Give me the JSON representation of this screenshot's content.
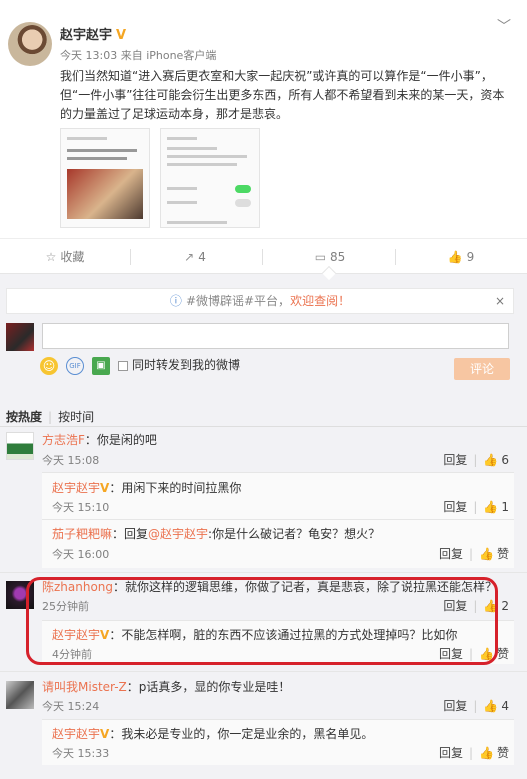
{
  "post": {
    "author": "赵宇赵宇",
    "verified_badge": "V",
    "meta": "今天 13:03 来自 iPhone客户端",
    "text": "我们当然知道“进入赛后更衣室和大家一起庆祝”或许真的可以算作是“一件小事”，但“一件小事”往往可能会衍生出更多东西，所有人都不希望看到未来的某一天，资本的力量盖过了足球运动本身，那才是悲哀。",
    "menu_icon": "chevron-down-icon"
  },
  "actions": {
    "favorite": "收藏",
    "forward": "4",
    "comment": "85",
    "like": "9"
  },
  "notice": {
    "tag": "#微博辟谣#平台，",
    "link": "欢迎查阅！",
    "close": "×"
  },
  "composer": {
    "also_forward": "同时转发到我的微博",
    "submit": "评论"
  },
  "sort": {
    "hot": "按热度",
    "time": "按时间"
  },
  "ops": {
    "reply": "回复",
    "like": "赞"
  },
  "comments": [
    {
      "name": "方志浩F",
      "text": "：你是闲的吧",
      "time": "今天 15:08",
      "likes": "6",
      "replies": [
        {
          "name": "赵宇赵宇",
          "text": "：用闲下来的时间拉黑你",
          "time": "今天 15:10",
          "likes": "1"
        },
        {
          "name": "茄子粑粑嘛",
          "pre": "：回复",
          "at": "@赵宇赵宇",
          "text": ":你是什么破记者？龟安？想火？",
          "time": "今天 16:00",
          "likes": "赞"
        }
      ]
    },
    {
      "name": "陈zhanhong",
      "text": "：就你这样的逻辑思维，你做了记者，真是悲哀，除了说拉黑还能怎样？",
      "time": "25分钟前",
      "likes": "2",
      "replies": [
        {
          "name": "赵宇赵宇",
          "text": "：不能怎样啊，脏的东西不应该通过拉黑的方式处理掉吗？比如你",
          "time": "4分钟前",
          "likes": "赞"
        }
      ]
    },
    {
      "name": "请叫我Mister-Z",
      "text": "：p话真多，显的你专业是哇！",
      "time": "今天 15:24",
      "likes": "4",
      "replies": [
        {
          "name": "赵宇赵宇",
          "text": "：我未必是专业的，你一定是业余的，黑名单见。",
          "time": "今天 15:33",
          "likes": "赞"
        }
      ]
    }
  ]
}
